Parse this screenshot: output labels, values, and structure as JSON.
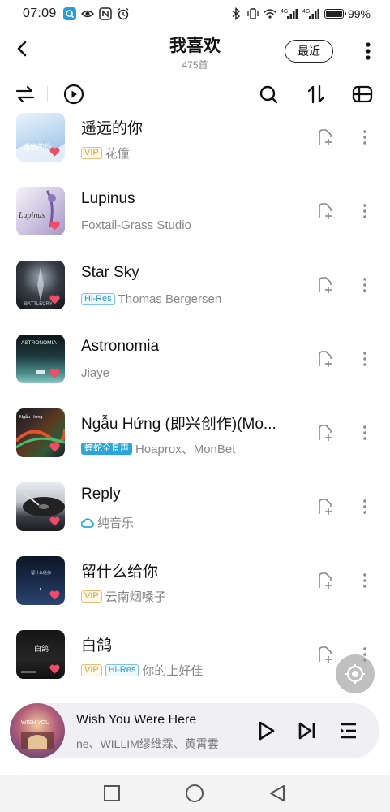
{
  "status_bar": {
    "time": "07:09",
    "battery_text": "99%",
    "battery_level": 0.99,
    "left_icons": [
      "search-app-icon",
      "eye-icon",
      "nfc-icon",
      "alarm-icon"
    ],
    "right_icons": [
      "bluetooth-icon",
      "vibrate-icon",
      "wifi-icon",
      "signal-4g-icon",
      "signal-4g-icon"
    ],
    "network_label_1": "4G",
    "network_label_2": "4G"
  },
  "header": {
    "title": "我喜欢",
    "subtitle": "475首",
    "recent_label": "最近",
    "back_icon": "back-arrow-icon",
    "more_icon": "more-vertical-icon"
  },
  "toolbar": {
    "icons": [
      "shuffle-icon",
      "play-circle-icon",
      "search-icon",
      "sort-icon",
      "batch-manage-icon"
    ]
  },
  "songs": [
    {
      "title": "遥远的你",
      "artist": "花僮",
      "badges": [
        "VIP"
      ],
      "cover_color": "#cfe2f2"
    },
    {
      "title": "Lupinus",
      "artist": "Foxtail-Grass Studio",
      "badges": [],
      "cover_color": "#d9d4e6"
    },
    {
      "title": "Star Sky",
      "artist": "Thomas Bergersen",
      "badges": [
        "Hi-Res"
      ],
      "cover_color": "#2a2d33"
    },
    {
      "title": "Astronomia",
      "artist": "Jiaye",
      "badges": [],
      "cover_color": "#2f6b6e"
    },
    {
      "title": "Ngẫu Hứng (即兴创作)(Mo...",
      "artist": "Hoaprox、MonBet",
      "badges": [
        "蝰蛇全景声"
      ],
      "cover_color": "#3a3a3a"
    },
    {
      "title": "Reply",
      "artist": "纯音乐",
      "badges": [
        "cloud"
      ],
      "cover_color": "#5b6470"
    },
    {
      "title": "留什么给你",
      "artist": "云南烟嗓子",
      "badges": [
        "VIP"
      ],
      "cover_color": "#1c2b44"
    },
    {
      "title": "白鸽",
      "artist": "你的上好佳",
      "badges": [
        "VIP",
        "Hi-Res"
      ],
      "cover_color": "#1d1d1f"
    }
  ],
  "row_icons": {
    "add": "add-to-playlist-icon",
    "more": "more-vertical-icon",
    "liked": "heart-icon"
  },
  "float_button_icon": "locate-current-icon",
  "player": {
    "title": "Wish You Were Here",
    "artist": "ne、WILLIM缪维霖、黄霄雲",
    "icons": [
      "play-icon",
      "next-icon",
      "playlist-icon"
    ]
  },
  "nav": {
    "icons": [
      "recent-apps-square-icon",
      "home-circle-icon",
      "back-triangle-icon"
    ]
  },
  "colors": {
    "accent_heart": "#f04b68",
    "vip": "#d9a33a",
    "hires": "#2b9bd6",
    "player_bg": "#efeff4"
  }
}
